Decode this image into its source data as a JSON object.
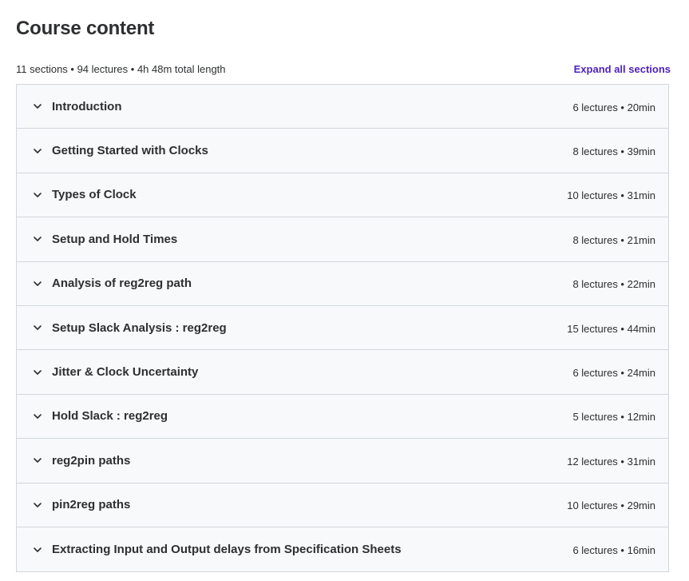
{
  "page": {
    "title": "Course content",
    "summary": "11 sections • 94 lectures • 4h 48m total length",
    "expand_all_label": "Expand all sections"
  },
  "colors": {
    "accent": "#5022c3",
    "section_bg": "#f7f9fa",
    "border": "#d1d7dc",
    "text": "#2d2f31"
  },
  "sections": [
    {
      "title": "Introduction",
      "meta": "6 lectures • 20min",
      "icon": "chevron-down-icon"
    },
    {
      "title": "Getting Started with Clocks",
      "meta": "8 lectures • 39min",
      "icon": "chevron-down-icon"
    },
    {
      "title": "Types of Clock",
      "meta": "10 lectures • 31min",
      "icon": "chevron-down-icon"
    },
    {
      "title": "Setup and Hold Times",
      "meta": "8 lectures • 21min",
      "icon": "chevron-down-icon"
    },
    {
      "title": "Analysis of reg2reg path",
      "meta": "8 lectures • 22min",
      "icon": "chevron-down-icon"
    },
    {
      "title": "Setup Slack Analysis : reg2reg",
      "meta": "15 lectures • 44min",
      "icon": "chevron-down-icon"
    },
    {
      "title": "Jitter & Clock Uncertainty",
      "meta": "6 lectures • 24min",
      "icon": "chevron-down-icon"
    },
    {
      "title": "Hold Slack : reg2reg",
      "meta": "5 lectures • 12min",
      "icon": "chevron-down-icon"
    },
    {
      "title": "reg2pin paths",
      "meta": "12 lectures • 31min",
      "icon": "chevron-down-icon"
    },
    {
      "title": "pin2reg paths",
      "meta": "10 lectures • 29min",
      "icon": "chevron-down-icon"
    },
    {
      "title": "Extracting Input and Output delays from Specification Sheets",
      "meta": "6 lectures • 16min",
      "icon": "chevron-down-icon"
    }
  ]
}
